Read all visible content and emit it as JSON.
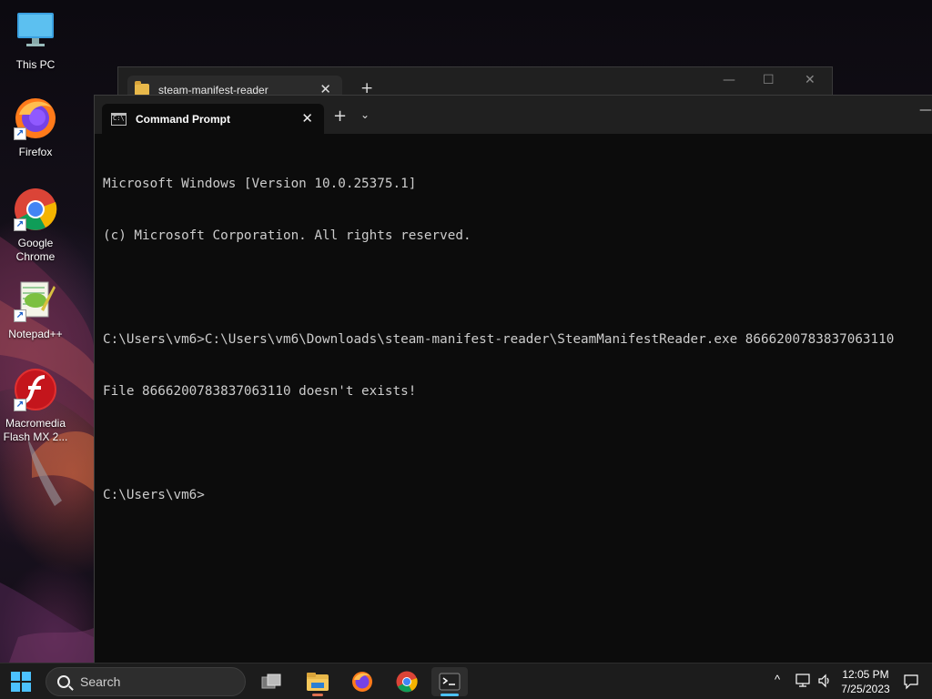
{
  "desktop": {
    "icons": [
      {
        "label": "This PC",
        "icon": "monitor-icon"
      },
      {
        "label": "Firefox",
        "icon": "firefox-icon"
      },
      {
        "label": "Google Chrome",
        "icon": "chrome-icon"
      },
      {
        "label": "Notepad++",
        "icon": "notepadpp-icon"
      },
      {
        "label": "Macromedia Flash MX 2...",
        "icon": "flash-icon"
      }
    ]
  },
  "back_window": {
    "tab_title": "steam-manifest-reader",
    "close_glyph": "✕",
    "new_tab_glyph": "+",
    "minimize_glyph": "—",
    "maximize_glyph": "☐",
    "close_window_glyph": "✕"
  },
  "terminal": {
    "tab_title": "Command Prompt",
    "close_glyph": "✕",
    "new_tab_glyph": "+",
    "dropdown_glyph": "⌄",
    "minimize_glyph": "—",
    "lines": [
      "Microsoft Windows [Version 10.0.25375.1]",
      "(c) Microsoft Corporation. All rights reserved.",
      "",
      "C:\\Users\\vm6>C:\\Users\\vm6\\Downloads\\steam-manifest-reader\\SteamManifestReader.exe 8666200783837063110",
      "File 8666200783837063110 doesn't exists!",
      "",
      "C:\\Users\\vm6>"
    ]
  },
  "taskbar": {
    "search_placeholder": "Search",
    "apps": [
      "task-view-icon",
      "file-explorer-icon",
      "firefox-icon",
      "chrome-icon",
      "terminal-icon"
    ],
    "active_app": "terminal-icon",
    "tray": {
      "chevron": "^",
      "time": "12:05 PM",
      "date": "7/25/2023"
    }
  },
  "colors": {
    "accent": "#4cc2ff",
    "terminal_bg": "#0c0c0c",
    "terminal_fg": "#cccccc",
    "titlebar": "#202020"
  }
}
